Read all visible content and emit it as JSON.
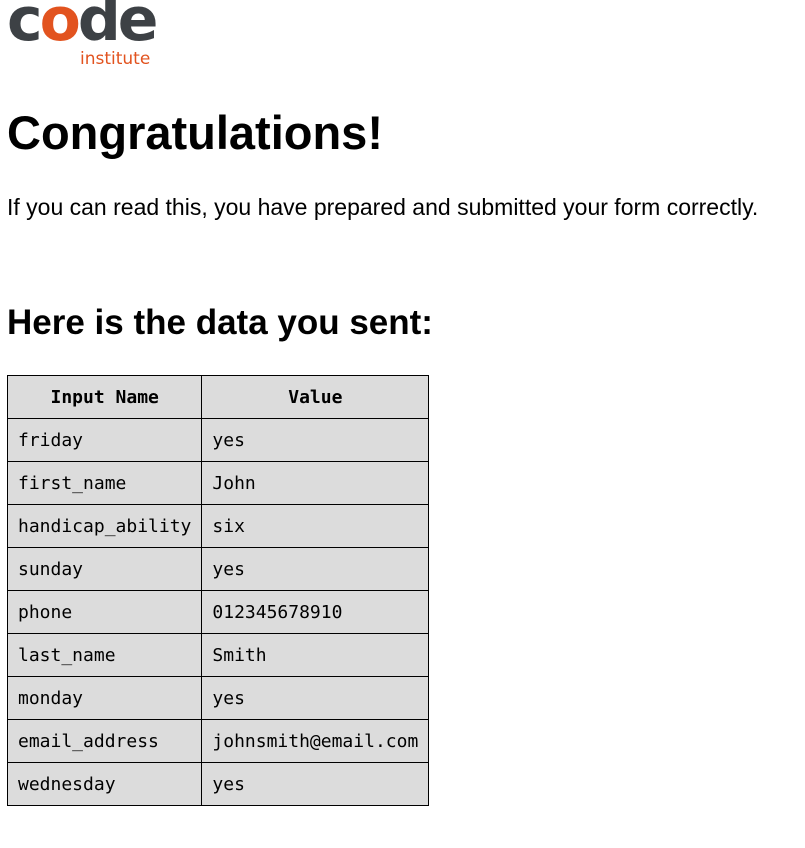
{
  "logo": {
    "main_prefix": "c",
    "main_accent": "o",
    "main_suffix": "de",
    "sub": "institute",
    "colors": {
      "dark": "#3d4145",
      "accent": "#e2531f"
    }
  },
  "heading": "Congratulations!",
  "intro": "If you can read this, you have prepared and submitted your form correctly.",
  "subheading": "Here is the data you sent:",
  "table": {
    "headers": [
      "Input Name",
      "Value"
    ],
    "rows": [
      [
        "friday",
        "yes"
      ],
      [
        "first_name",
        "John"
      ],
      [
        "handicap_ability",
        "six"
      ],
      [
        "sunday",
        "yes"
      ],
      [
        "phone",
        "012345678910"
      ],
      [
        "last_name",
        "Smith"
      ],
      [
        "monday",
        "yes"
      ],
      [
        "email_address",
        "johnsmith@email.com"
      ],
      [
        "wednesday",
        "yes"
      ]
    ]
  }
}
